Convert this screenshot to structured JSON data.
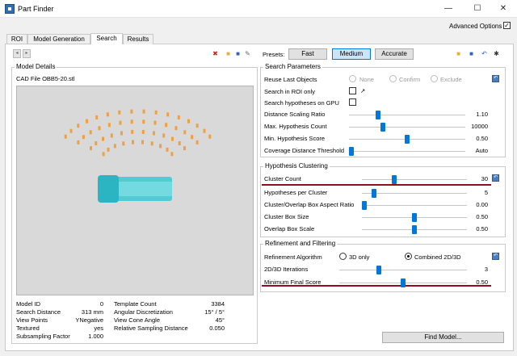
{
  "window": {
    "title": "Part Finder",
    "minimize": "—",
    "maximize": "☐",
    "close": "✕"
  },
  "advanced_options": {
    "label": "Advanced Options",
    "checked": "✓"
  },
  "tabs": [
    {
      "label": "ROI"
    },
    {
      "label": "Model Generation"
    },
    {
      "label": "Search"
    },
    {
      "label": "Results"
    }
  ],
  "toolbar": {
    "prev": "◂",
    "next": "▸",
    "delete": "✖",
    "open": "■",
    "save": "■",
    "tool": "✎"
  },
  "model_details": {
    "title": "Model Details",
    "cad_file": "CAD File OBB5-20.stl",
    "info": [
      {
        "label": "Model ID",
        "value": "0"
      },
      {
        "label": "Search Distance",
        "value": "313 mm"
      },
      {
        "label": "View Points",
        "value": "YNegative"
      },
      {
        "label": "Textured",
        "value": "yes"
      },
      {
        "label": "Subsampling Factor",
        "value": "1.000"
      }
    ],
    "info2": [
      {
        "label": "Template Count",
        "value": "3384"
      },
      {
        "label": "Angular Discretization",
        "value": "15°  / 5°"
      },
      {
        "label": "View Cone Angle",
        "value": "45°"
      },
      {
        "label": "Relative Sampling Distance",
        "value": "0.050"
      }
    ]
  },
  "presets": {
    "label": "Presets:",
    "buttons": [
      {
        "label": "Fast"
      },
      {
        "label": "Medium"
      },
      {
        "label": "Accurate"
      }
    ]
  },
  "search_parameters": {
    "title": "Search Parameters",
    "reuse_label": "Reuse Last Objects",
    "reuse_options": [
      "None",
      "Confirm",
      "Exclude"
    ],
    "roi_only_label": "Search in ROI only",
    "gpu_label": "Search hypotheses on  GPU",
    "sliders": [
      {
        "label": "Distance Scaling Ratio",
        "value": "1.10",
        "level": 0.24
      },
      {
        "label": "Max. Hypothesis Count",
        "value": "10000",
        "level": 0.28
      },
      {
        "label": "Min. Hypothesis Score",
        "value": "0.50",
        "level": 0.5
      },
      {
        "label": "Coverage Distance Threshold",
        "value": "Auto",
        "level": 0.0
      }
    ]
  },
  "hypothesis_clustering": {
    "title": "Hypothesis Clustering",
    "sliders": [
      {
        "label": "Cluster Count",
        "value": "30",
        "level": 0.3
      },
      {
        "label": "Hypotheses per Cluster",
        "value": "5",
        "level": 0.1
      },
      {
        "label": "Cluster/Overlap Box Aspect Ratio",
        "value": "0.00",
        "level": 0.0
      },
      {
        "label": "Cluster Box Size",
        "value": "0.50",
        "level": 0.5
      },
      {
        "label": "Overlap Box Scale",
        "value": "0.50",
        "level": 0.5
      }
    ]
  },
  "refinement": {
    "title": "Refinement and Filtering",
    "algorithm_label": "Refinement Algorithm",
    "algorithm_options": [
      "3D only",
      "Combined 2D/3D"
    ],
    "sliders": [
      {
        "label": "2D/3D Iterations",
        "value": "3",
        "level": 0.3
      },
      {
        "label": "Minimum Final Score",
        "value": "0.50",
        "level": 0.5
      }
    ]
  },
  "find_model": {
    "label": "Find Model..."
  },
  "colors": {
    "accent": "#0078d7",
    "highlight": "#8b1020",
    "points_orange": "#f0a040",
    "points_cyan": "#3cc8d0"
  }
}
